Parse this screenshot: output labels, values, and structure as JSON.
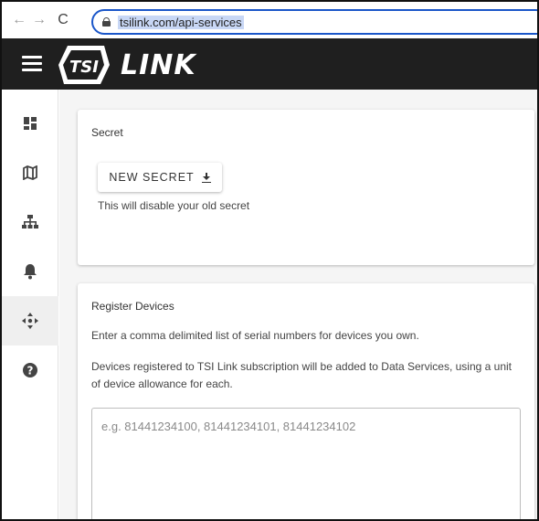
{
  "browser": {
    "back_glyph": "←",
    "forward_glyph": "→",
    "reload_glyph": "C",
    "url": "tsilink.com/api-services"
  },
  "header": {
    "logo_mark": "TSI",
    "logo_text": "LINK"
  },
  "sidebar": {
    "items": [
      {
        "name": "dashboard-icon",
        "active": false
      },
      {
        "name": "map-icon",
        "active": false
      },
      {
        "name": "hierarchy-icon",
        "active": false
      },
      {
        "name": "bell-icon",
        "active": false
      },
      {
        "name": "move-arrows-icon",
        "active": true
      },
      {
        "name": "help-icon",
        "active": false
      }
    ]
  },
  "secret_card": {
    "title": "Secret",
    "button_label": "NEW SECRET",
    "button_icon": "download-icon",
    "note": "This will disable your old secret"
  },
  "register_card": {
    "title": "Register Devices",
    "instruction": "Enter a comma delimited list of serial numbers for devices you own.",
    "description": "Devices registered to TSI Link subscription will be added to Data Services, using a unit of device allowance for each.",
    "textarea_value": "",
    "textarea_placeholder": "e.g. 81441234100, 81441234101, 81441234102"
  },
  "colors": {
    "header_bg": "#1f1f1f",
    "url_focus_border": "#1a56c9",
    "content_bg": "#f5f5f5",
    "active_rail_bg": "#efefef"
  }
}
